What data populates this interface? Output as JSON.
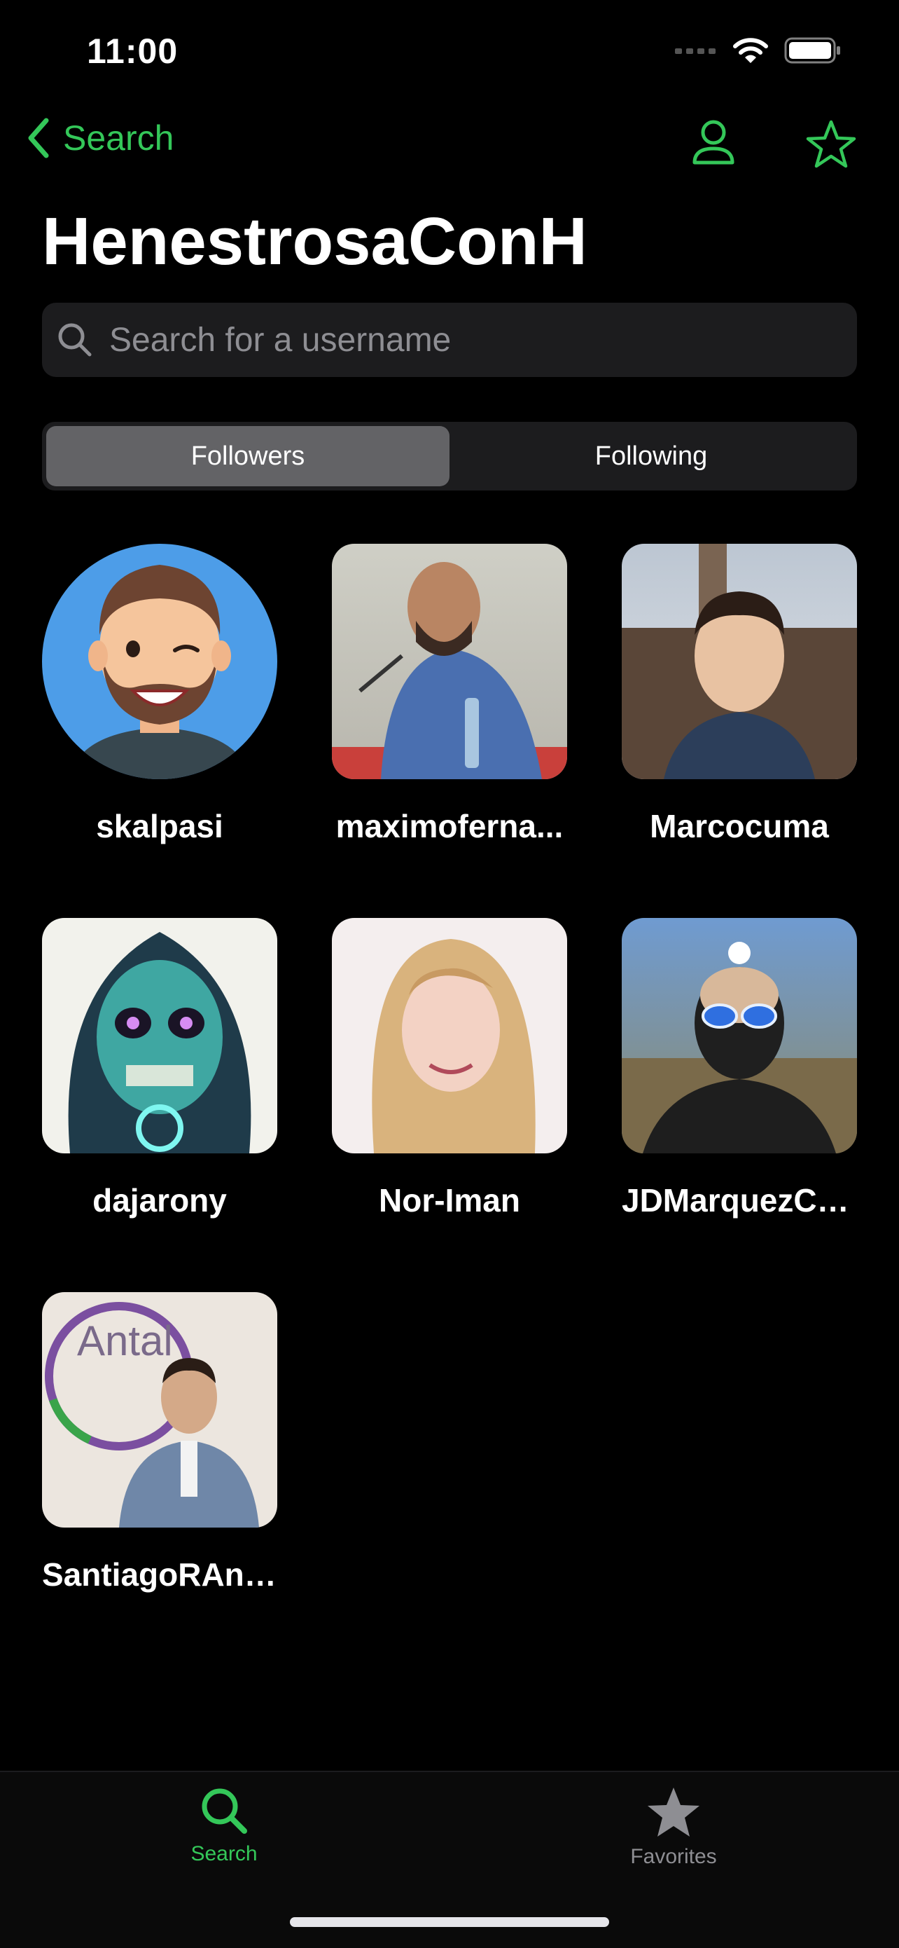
{
  "status_bar": {
    "time": "11:00"
  },
  "nav": {
    "back_label": "Search",
    "title": "HenestrosaConH"
  },
  "search": {
    "placeholder": "Search for a username",
    "value": ""
  },
  "segments": [
    {
      "label": "Followers",
      "selected": true
    },
    {
      "label": "Following",
      "selected": false
    }
  ],
  "users": [
    {
      "username": "skalpasi"
    },
    {
      "username": "maximoferna..."
    },
    {
      "username": "Marcocuma"
    },
    {
      "username": "dajarony"
    },
    {
      "username": "Nor-Iman"
    },
    {
      "username": "JDMarquezCLC"
    },
    {
      "username": "SantiagoRAntal"
    }
  ],
  "tabbar": {
    "items": [
      {
        "label": "Search",
        "icon": "search-icon",
        "active": true
      },
      {
        "label": "Favorites",
        "icon": "star-icon",
        "active": false
      }
    ]
  },
  "colors": {
    "accent": "#34c759",
    "background": "#000000",
    "inactive": "#8e8e93"
  }
}
